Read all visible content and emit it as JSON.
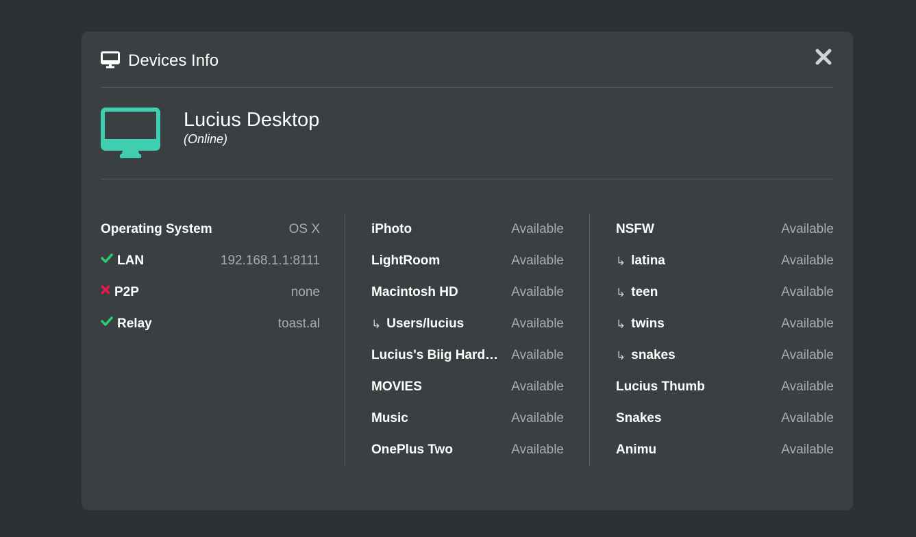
{
  "header": {
    "title": "Devices Info",
    "icon": "monitor-icon",
    "close_icon": "close-icon"
  },
  "device": {
    "name": "Lucius Desktop",
    "status": "(Online)",
    "icon_color": "#3fcfb0"
  },
  "info": [
    {
      "label": "Operating System",
      "value": "OS X"
    },
    {
      "label": "LAN",
      "value": "192.168.1.1:8111",
      "status": "ok"
    },
    {
      "label": "P2P",
      "value": "none",
      "status": "fail"
    },
    {
      "label": "Relay",
      "value": "toast.al",
      "status": "ok"
    }
  ],
  "drives_left": [
    {
      "label": "iPhoto",
      "value": "Available"
    },
    {
      "label": "LightRoom",
      "value": "Available"
    },
    {
      "label": "Macintosh HD",
      "value": "Available"
    },
    {
      "label": "Users/lucius",
      "value": "Available",
      "sub": true
    },
    {
      "label": "Lucius's Biig Hard…",
      "value": "Available"
    },
    {
      "label": "MOVIES",
      "value": "Available"
    },
    {
      "label": "Music",
      "value": "Available"
    },
    {
      "label": "OnePlus Two",
      "value": "Available"
    }
  ],
  "drives_right": [
    {
      "label": "NSFW",
      "value": "Available"
    },
    {
      "label": "latina",
      "value": "Available",
      "sub": true
    },
    {
      "label": "teen",
      "value": "Available",
      "sub": true
    },
    {
      "label": "twins",
      "value": "Available",
      "sub": true
    },
    {
      "label": "snakes",
      "value": "Available",
      "sub": true
    },
    {
      "label": "Lucius Thumb",
      "value": "Available"
    },
    {
      "label": "Snakes",
      "value": "Available"
    },
    {
      "label": "Animu",
      "value": "Available"
    }
  ],
  "sub_marker": "↳",
  "colors": {
    "ok": "#2ecc71",
    "fail": "#e8194f",
    "accent": "#3fcfb0"
  }
}
